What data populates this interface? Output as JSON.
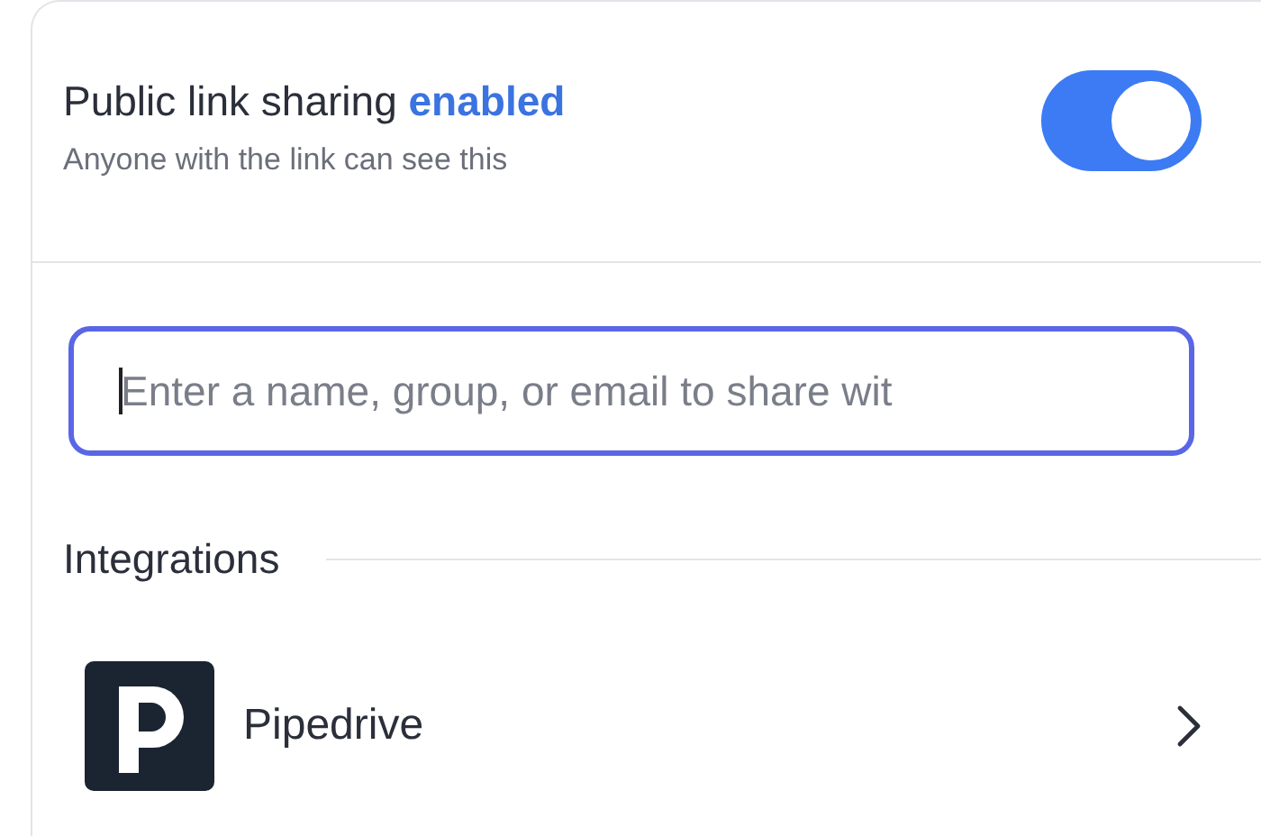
{
  "sharing": {
    "title": "Public link sharing",
    "status": "enabled",
    "subtitle": "Anyone with the link can see this",
    "on": true
  },
  "share_field": {
    "placeholder": "Enter a name, group, or email to share wit",
    "focused": true
  },
  "integrations": {
    "heading": "Integrations",
    "items": [
      {
        "name": "Pipedrive"
      }
    ]
  }
}
